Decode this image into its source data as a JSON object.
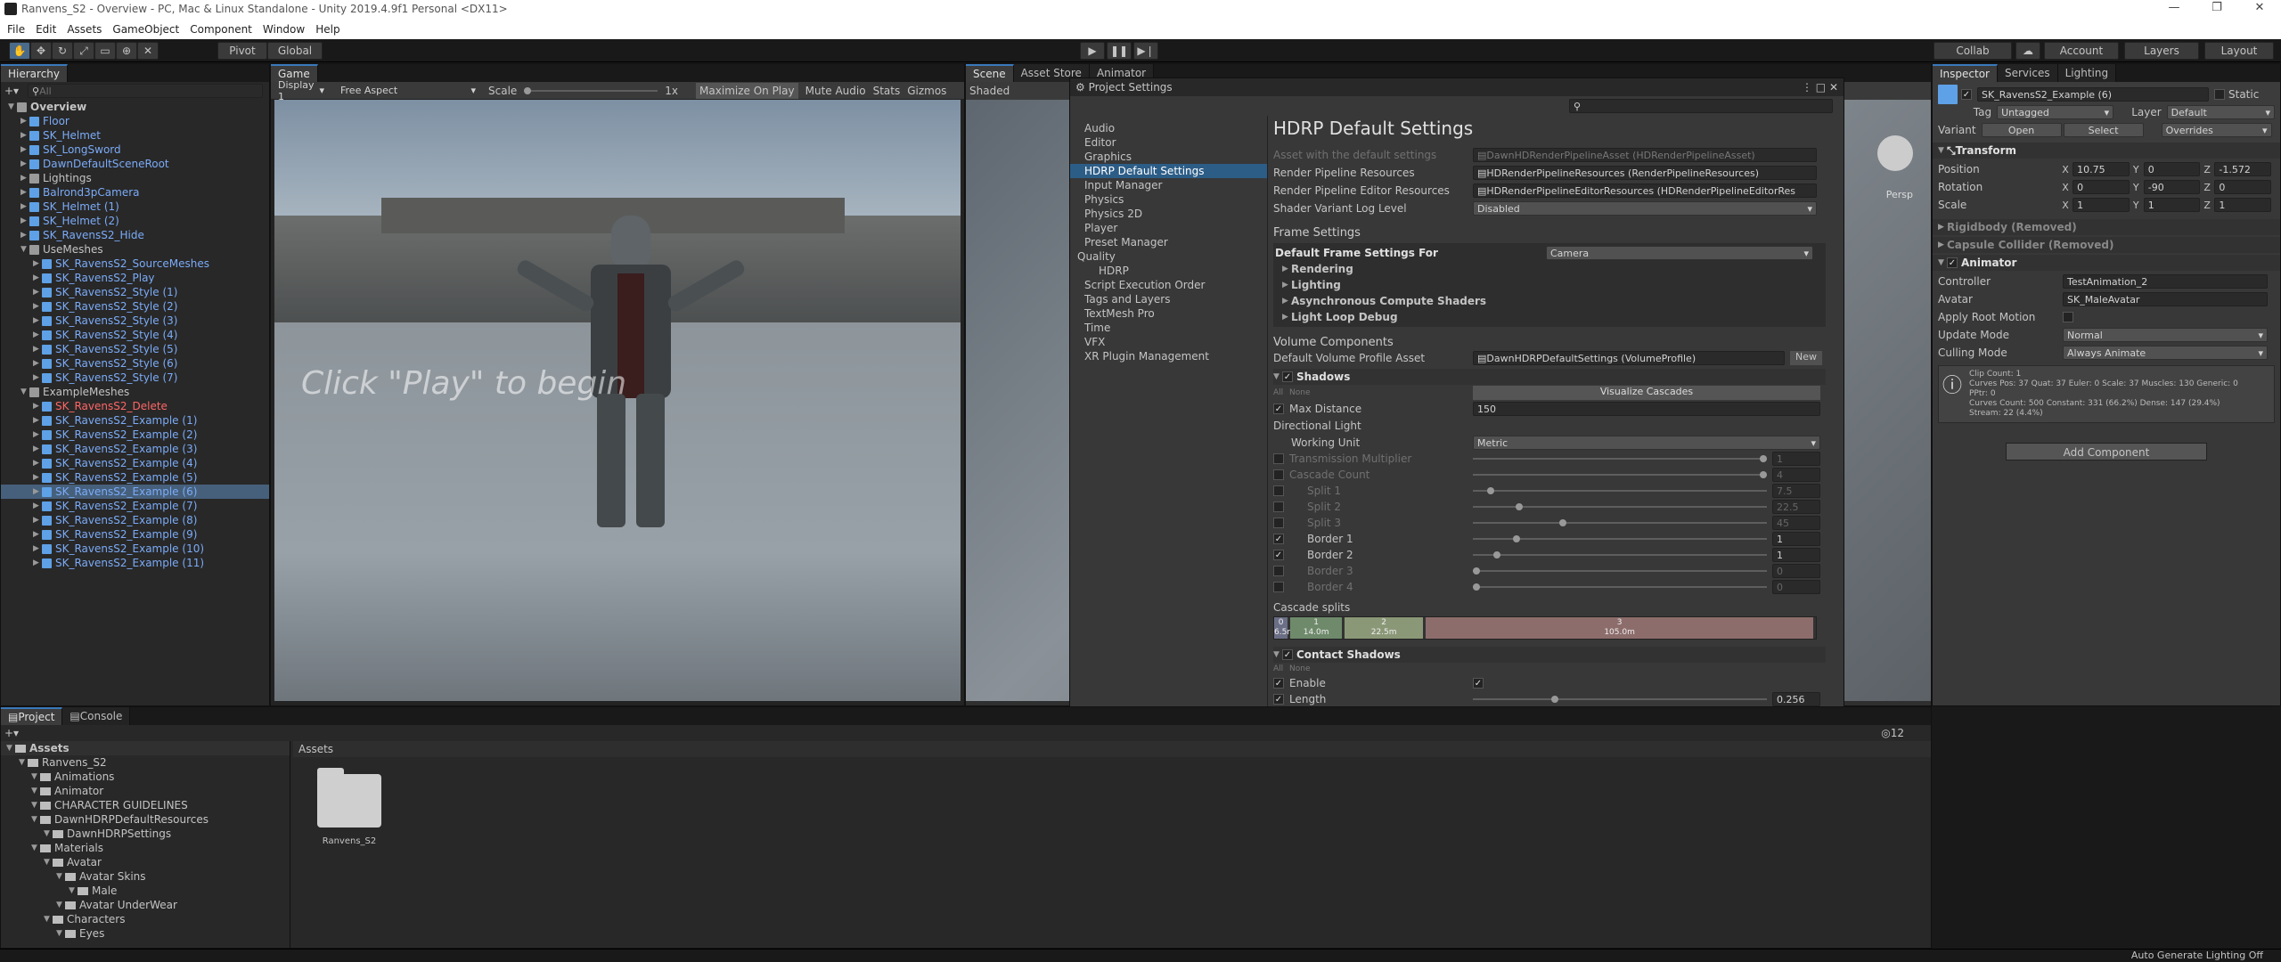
{
  "window": {
    "title": "Ranvens_S2 - Overview - PC, Mac & Linux Standalone - Unity 2019.4.9f1 Personal <DX11>",
    "min": "—",
    "max": "❐",
    "close": "✕"
  },
  "menu": [
    "File",
    "Edit",
    "Assets",
    "GameObject",
    "Component",
    "Window",
    "Help"
  ],
  "toolbar": {
    "pivot": "Pivot",
    "global": "Global",
    "collab": "Collab",
    "account": "Account",
    "layers": "Layers",
    "layout": "Layout"
  },
  "hierarchy": {
    "tab": "Hierarchy",
    "search": "All",
    "rows": [
      {
        "t": "Overview",
        "d": 0,
        "k": "scene"
      },
      {
        "t": "Floor",
        "d": 1,
        "k": "b"
      },
      {
        "t": "SK_Helmet",
        "d": 1,
        "k": "b"
      },
      {
        "t": "SK_LongSword",
        "d": 1,
        "k": "b"
      },
      {
        "t": "DawnDefaultSceneRoot",
        "d": 1,
        "k": "b"
      },
      {
        "t": "Lightings",
        "d": 1,
        "k": "w"
      },
      {
        "t": "Balrond3pCamera",
        "d": 1,
        "k": "b"
      },
      {
        "t": "SK_Helmet (1)",
        "d": 1,
        "k": "b"
      },
      {
        "t": "SK_Helmet (2)",
        "d": 1,
        "k": "b"
      },
      {
        "t": "SK_RavensS2_Hide",
        "d": 1,
        "k": "b"
      },
      {
        "t": "UseMeshes",
        "d": 1,
        "k": "w"
      },
      {
        "t": "SK_RavensS2_SourceMeshes",
        "d": 2,
        "k": "b"
      },
      {
        "t": "SK_RavensS2_Play",
        "d": 2,
        "k": "b"
      },
      {
        "t": "SK_RavensS2_Style (1)",
        "d": 2,
        "k": "b"
      },
      {
        "t": "SK_RavensS2_Style (2)",
        "d": 2,
        "k": "b"
      },
      {
        "t": "SK_RavensS2_Style (3)",
        "d": 2,
        "k": "b"
      },
      {
        "t": "SK_RavensS2_Style (4)",
        "d": 2,
        "k": "b"
      },
      {
        "t": "SK_RavensS2_Style (5)",
        "d": 2,
        "k": "b"
      },
      {
        "t": "SK_RavensS2_Style (6)",
        "d": 2,
        "k": "b"
      },
      {
        "t": "SK_RavensS2_Style (7)",
        "d": 2,
        "k": "b"
      },
      {
        "t": "ExampleMeshes",
        "d": 1,
        "k": "w"
      },
      {
        "t": "SK_RavensS2_Delete",
        "d": 2,
        "k": "r"
      },
      {
        "t": "SK_RavensS2_Example (1)",
        "d": 2,
        "k": "b"
      },
      {
        "t": "SK_RavensS2_Example (2)",
        "d": 2,
        "k": "b"
      },
      {
        "t": "SK_RavensS2_Example (3)",
        "d": 2,
        "k": "b"
      },
      {
        "t": "SK_RavensS2_Example (4)",
        "d": 2,
        "k": "b"
      },
      {
        "t": "SK_RavensS2_Example (5)",
        "d": 2,
        "k": "b"
      },
      {
        "t": "SK_RavensS2_Example (6)",
        "d": 2,
        "k": "sel"
      },
      {
        "t": "SK_RavensS2_Example (7)",
        "d": 2,
        "k": "b"
      },
      {
        "t": "SK_RavensS2_Example (8)",
        "d": 2,
        "k": "b"
      },
      {
        "t": "SK_RavensS2_Example (9)",
        "d": 2,
        "k": "b"
      },
      {
        "t": "SK_RavensS2_Example (10)",
        "d": 2,
        "k": "b"
      },
      {
        "t": "SK_RavensS2_Example (11)",
        "d": 2,
        "k": "b"
      }
    ]
  },
  "game": {
    "tab": "Game",
    "display": "Display 1",
    "aspect": "Free Aspect",
    "scale_label": "Scale",
    "scale_val": "1x",
    "maximize": "Maximize On Play",
    "mute": "Mute Audio",
    "stats": "Stats",
    "gizmos": "Gizmos",
    "overlay": "Click \"Play\" to begin"
  },
  "scene": {
    "tab": "Scene",
    "asset_store": "Asset Store",
    "animator": "Animator",
    "shaded": "Shaded",
    "persp": "Persp"
  },
  "project_settings": {
    "title": "Project Settings",
    "categories": [
      "Audio",
      "Editor",
      "Graphics",
      "HDRP Default Settings",
      "Input Manager",
      "Physics",
      "Physics 2D",
      "Player",
      "Preset Manager",
      "Quality",
      "HDRP",
      "Script Execution Order",
      "Tags and Layers",
      "TextMesh Pro",
      "Time",
      "VFX",
      "XR Plugin Management"
    ],
    "heading": "HDRP Default Settings",
    "asset_label": "Asset with the default settings",
    "asset_val": "DawnHDRenderPipelineAsset (HDRenderPipelineAsset)",
    "rp_res_label": "Render Pipeline Resources",
    "rp_res_val": "HDRenderPipelineResources (RenderPipelineResources)",
    "rp_ed_label": "Render Pipeline Editor Resources",
    "rp_ed_val": "HDRenderPipelineEditorResources (HDRenderPipelineEditorRes",
    "svl_label": "Shader Variant Log Level",
    "svl_val": "Disabled",
    "frame_settings": "Frame Settings",
    "dfs_label": "Default Frame Settings For",
    "dfs_val": "Camera",
    "fs_items": [
      "Rendering",
      "Lighting",
      "Asynchronous Compute Shaders",
      "Light Loop Debug"
    ],
    "vol_comp": "Volume Components",
    "dvp_label": "Default Volume Profile Asset",
    "dvp_val": "DawnHDRPDefaultSettings (VolumeProfile)",
    "new_btn": "New",
    "shadows": "Shadows",
    "all": "All",
    "none": "None",
    "visualize": "Visualize Cascades",
    "maxdist_label": "Max Distance",
    "maxdist_val": "150",
    "dir_light": "Directional Light",
    "wu_label": "Working Unit",
    "wu_val": "Metric",
    "tm_label": "Transmission Multiplier",
    "tm_val": "1",
    "cc_label": "Cascade Count",
    "cc_val": "4",
    "split1": "Split 1",
    "split1_val": "7.5",
    "split2": "Split 2",
    "split2_val": "22.5",
    "split3": "Split 3",
    "split3_val": "45",
    "border1": "Border 1",
    "border1_val": "1",
    "border2": "Border 2",
    "border2_val": "1",
    "border3": "Border 3",
    "border3_val": "0",
    "border4": "Border 4",
    "border4_val": "0",
    "cascade_splits": "Cascade splits",
    "cascades": [
      {
        "n": "0",
        "d": "6.5m",
        "w": 3,
        "c": "#6b6f86"
      },
      {
        "n": "1",
        "d": "14.0m",
        "w": 10,
        "c": "#6e8a6b"
      },
      {
        "n": "2",
        "d": "22.5m",
        "w": 15,
        "c": "#8b9877"
      },
      {
        "n": "3",
        "d": "105.0m",
        "w": 72,
        "c": "#8d6d6c"
      }
    ],
    "contact": "Contact Shadows",
    "enable_label": "Enable",
    "length_label": "Length",
    "length_val": "0.256"
  },
  "inspector": {
    "tab": "Inspector",
    "services": "Services",
    "lighting": "Lighting",
    "obj_name": "SK_RavensS2_Example (6)",
    "static": "Static",
    "tag_label": "Tag",
    "tag_val": "Untagged",
    "layer_label": "Layer",
    "layer_val": "Default",
    "variant_label": "Variant",
    "open": "Open",
    "select": "Select",
    "overrides": "Overrides",
    "transform": "Transform",
    "pos_label": "Position",
    "pos": [
      "10.75",
      "0",
      "-1.572"
    ],
    "rot_label": "Rotation",
    "rot": [
      "0",
      "-90",
      "0"
    ],
    "scale_label": "Scale",
    "scale": [
      "1",
      "1",
      "1"
    ],
    "rigidbody": "Rigidbody (Removed)",
    "capsule": "Capsule Collider (Removed)",
    "animator": "Animator",
    "controller_label": "Controller",
    "controller_val": "TestAnimation_2",
    "avatar_label": "Avatar",
    "avatar_val": "SK_MaleAvatar",
    "root_motion": "Apply Root Motion",
    "update_label": "Update Mode",
    "update_val": "Normal",
    "culling_label": "Culling Mode",
    "culling_val": "Always Animate",
    "clip_info": [
      "Clip Count: 1",
      "Curves Pos: 37 Quat: 37 Euler: 0 Scale: 37 Muscles: 130 Generic: 0",
      "PPtr: 0",
      "Curves Count: 500 Constant: 331 (66.2%) Dense: 147 (29.4%)",
      "Stream: 22 (4.4%)"
    ],
    "add_component": "Add Component"
  },
  "project": {
    "tab": "Project",
    "console": "Console",
    "tree": [
      {
        "t": "Assets",
        "d": 0,
        "b": true
      },
      {
        "t": "Ranvens_S2",
        "d": 1
      },
      {
        "t": "Animations",
        "d": 2
      },
      {
        "t": "Animator",
        "d": 2
      },
      {
        "t": "CHARACTER GUIDELINES",
        "d": 2
      },
      {
        "t": "DawnHDRPDefaultResources",
        "d": 2
      },
      {
        "t": "DawnHDRPSettings",
        "d": 3
      },
      {
        "t": "Materials",
        "d": 2
      },
      {
        "t": "Avatar",
        "d": 3
      },
      {
        "t": "Avatar Skins",
        "d": 4
      },
      {
        "t": "Male",
        "d": 5
      },
      {
        "t": "Avatar UnderWear",
        "d": 4
      },
      {
        "t": "Characters",
        "d": 3
      },
      {
        "t": "Eyes",
        "d": 4
      }
    ],
    "breadcrumb": "Assets",
    "folder": "Ranvens_S2",
    "hidden_count": "12"
  },
  "status": {
    "text": "Auto Generate Lighting Off"
  }
}
